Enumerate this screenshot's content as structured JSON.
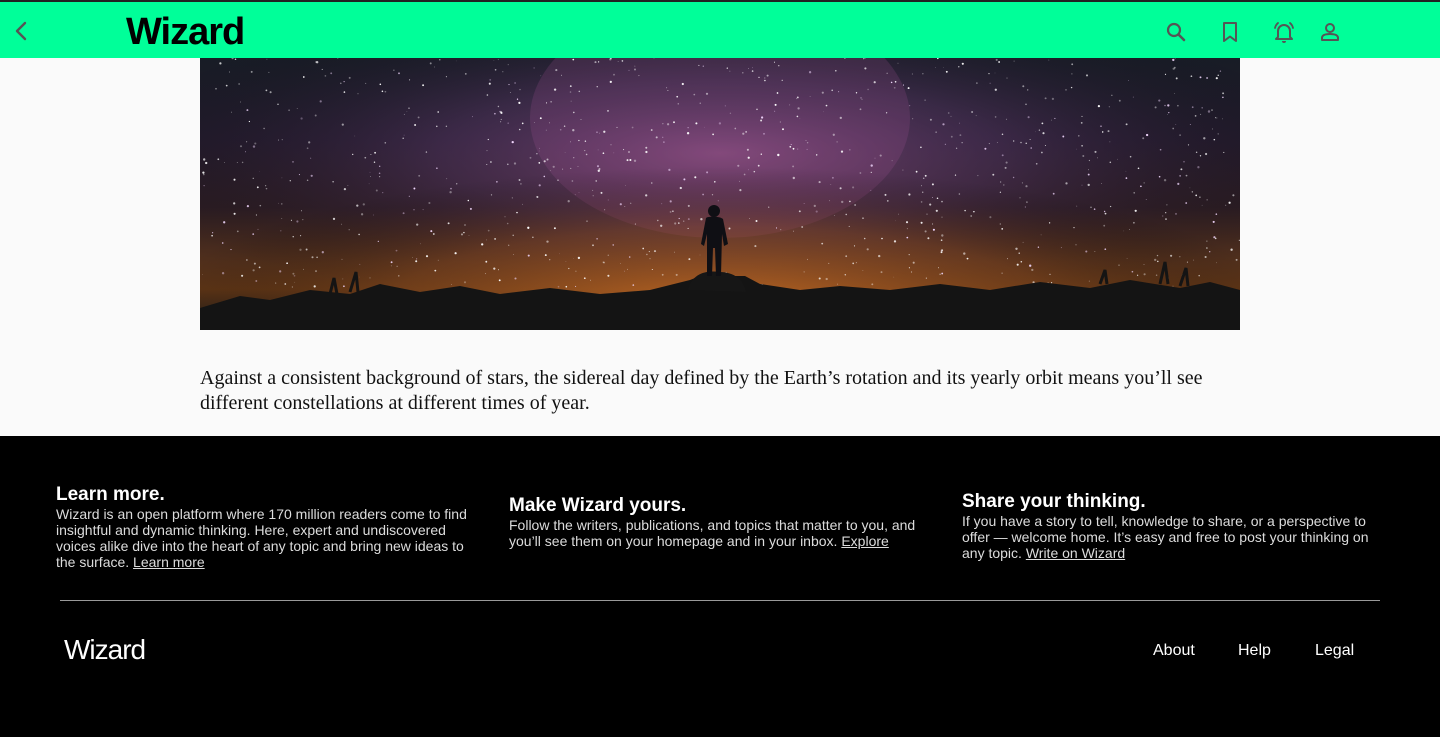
{
  "header": {
    "logo": "Wizard",
    "background_color": "#00ff99",
    "icons": [
      "chevron-left-icon",
      "search-icon",
      "bookmark-icon",
      "notification-bell-icon",
      "user-icon"
    ]
  },
  "hero": {
    "description_icon": "night-sky-photo"
  },
  "article": {
    "paragraph": "Against a consistent background of stars, the sidereal day defined by the Earth’s rotation and its yearly orbit means you’ll see different constellations at different times of year."
  },
  "footer": {
    "columns": [
      {
        "title": "Learn more.",
        "text": "Wizard is an open platform where 170 million readers come to find insightful and dynamic thinking. Here, expert and undiscovered voices alike dive into the heart of any topic and bring new ideas to the surface.",
        "link": "Learn more"
      },
      {
        "title": "Make Wizard yours.",
        "text": "Follow the writers, publications, and topics that matter to you, and you’ll see them on your homepage and in your inbox.",
        "link": "Explore"
      },
      {
        "title": "Share your thinking.",
        "text": "If you have a story to tell, knowledge to share, or a perspective to offer — welcome home. It’s easy and free to post your thinking on any topic.",
        "link": "Write on Wizard"
      }
    ],
    "logo": "Wizard",
    "links": [
      "About",
      "Help",
      "Legal"
    ]
  }
}
